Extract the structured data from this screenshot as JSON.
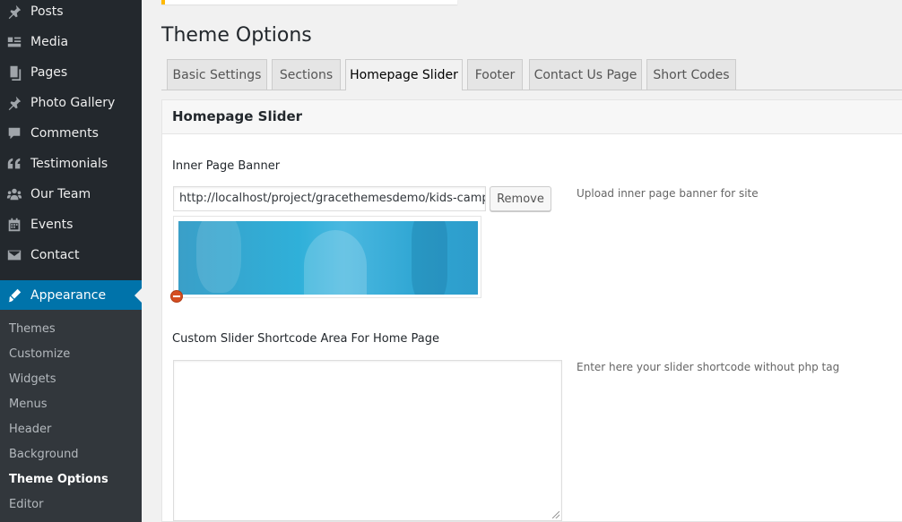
{
  "sidebar": {
    "items": [
      {
        "label": "Posts",
        "icon": "pin-icon"
      },
      {
        "label": "Media",
        "icon": "media-icon"
      },
      {
        "label": "Pages",
        "icon": "pages-icon"
      },
      {
        "label": "Photo Gallery",
        "icon": "pin-icon"
      },
      {
        "label": "Comments",
        "icon": "comment-icon"
      },
      {
        "label": "Testimonials",
        "icon": "quote-icon"
      },
      {
        "label": "Our Team",
        "icon": "team-icon"
      },
      {
        "label": "Events",
        "icon": "calendar-icon"
      },
      {
        "label": "Contact",
        "icon": "mail-icon"
      }
    ],
    "current": {
      "label": "Appearance",
      "icon": "paintbrush-icon"
    },
    "submenu": [
      "Themes",
      "Customize",
      "Widgets",
      "Menus",
      "Header",
      "Background",
      "Theme Options",
      "Editor"
    ],
    "active_sub": "Theme Options"
  },
  "page": {
    "title": "Theme Options"
  },
  "tabs": [
    "Basic Settings",
    "Sections",
    "Homepage Slider",
    "Footer",
    "Contact Us Page",
    "Short Codes"
  ],
  "active_tab": "Homepage Slider",
  "panel": {
    "title": "Homepage Slider",
    "banner_label": "Inner Page Banner",
    "banner_url": "http://localhost/project/gracethemesdemo/kids-campus",
    "remove_label": "Remove",
    "banner_desc": "Upload inner page banner for site",
    "shortcode_label": "Custom Slider Shortcode Area For Home Page",
    "shortcode_desc": "Enter here your slider shortcode without php tag",
    "shortcode_value": ""
  },
  "colors": {
    "sidebar_bg": "#23282d",
    "submenu_bg": "#32373c",
    "accent": "#0073aa",
    "notice": "#ffb900"
  }
}
